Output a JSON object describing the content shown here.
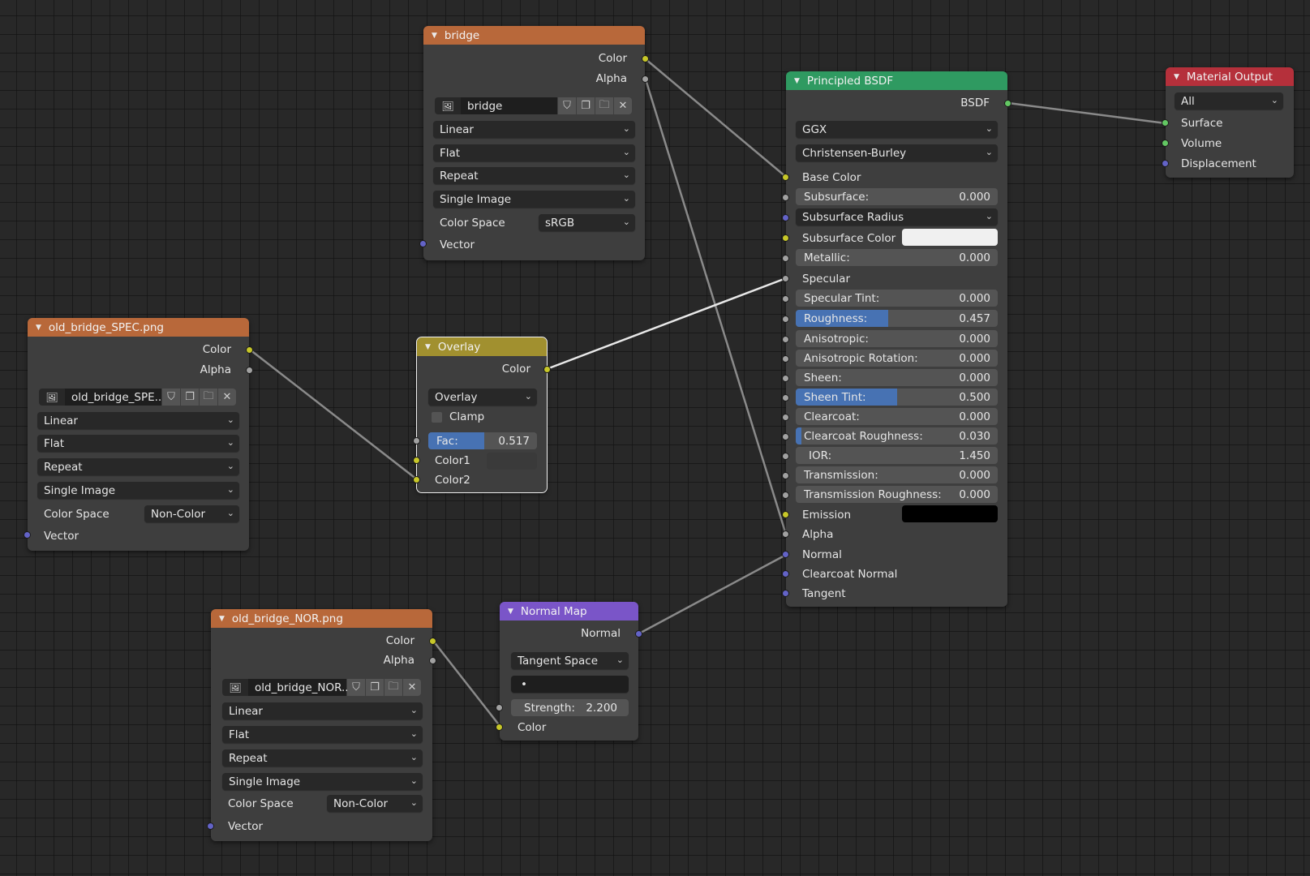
{
  "editor": "Shader Editor",
  "nodes": {
    "bridge": {
      "title": "bridge",
      "outputs": [
        "Color",
        "Alpha"
      ],
      "image_name": "bridge",
      "interpolation": "Linear",
      "projection": "Flat",
      "extension": "Repeat",
      "source": "Single Image",
      "color_space_label": "Color Space",
      "color_space": "sRGB",
      "inputs": [
        "Vector"
      ]
    },
    "spec": {
      "title": "old_bridge_SPEC.png",
      "outputs": [
        "Color",
        "Alpha"
      ],
      "image_name": "old_bridge_SPE..",
      "interpolation": "Linear",
      "projection": "Flat",
      "extension": "Repeat",
      "source": "Single Image",
      "color_space_label": "Color Space",
      "color_space": "Non-Color",
      "inputs": [
        "Vector"
      ]
    },
    "nor": {
      "title": "old_bridge_NOR.png",
      "outputs": [
        "Color",
        "Alpha"
      ],
      "image_name": "old_bridge_NOR..",
      "interpolation": "Linear",
      "projection": "Flat",
      "extension": "Repeat",
      "source": "Single Image",
      "color_space_label": "Color Space",
      "color_space": "Non-Color",
      "inputs": [
        "Vector"
      ]
    },
    "overlay": {
      "title": "Overlay",
      "output": "Color",
      "blend_type": "Overlay",
      "clamp_label": "Clamp",
      "clamp": false,
      "fac_label": "Fac:",
      "fac": 0.517,
      "fac_text": "0.517",
      "color1": "Color1",
      "color2": "Color2",
      "selected": true
    },
    "normal_map": {
      "title": "Normal Map",
      "output": "Normal",
      "space": "Tangent Space",
      "uv_map": "•",
      "strength_label": "Strength:",
      "strength": "2.200",
      "color_input": "Color"
    },
    "bsdf": {
      "title": "Principled BSDF",
      "output": "BSDF",
      "distribution": "GGX",
      "subsurface_method": "Christensen-Burley",
      "base_color": "Base Color",
      "subsurface": {
        "label": "Subsurface:",
        "value": "0.000",
        "fraction": 0
      },
      "subsurface_radius": "Subsurface Radius",
      "subsurface_color": {
        "label": "Subsurface Color",
        "color": "#f0f0f0"
      },
      "metallic": {
        "label": "Metallic:",
        "value": "0.000",
        "fraction": 0
      },
      "specular": "Specular",
      "specular_tint": {
        "label": "Specular Tint:",
        "value": "0.000",
        "fraction": 0
      },
      "roughness": {
        "label": "Roughness:",
        "value": "0.457",
        "fraction": 0.457
      },
      "anisotropic": {
        "label": "Anisotropic:",
        "value": "0.000",
        "fraction": 0
      },
      "anisotropic_rotation": {
        "label": "Anisotropic Rotation:",
        "value": "0.000",
        "fraction": 0
      },
      "sheen": {
        "label": "Sheen:",
        "value": "0.000",
        "fraction": 0
      },
      "sheen_tint": {
        "label": "Sheen Tint:",
        "value": "0.500",
        "fraction": 0.5
      },
      "clearcoat": {
        "label": "Clearcoat:",
        "value": "0.000",
        "fraction": 0
      },
      "clearcoat_roughness": {
        "label": "Clearcoat Roughness:",
        "value": "0.030",
        "fraction": 0.03
      },
      "ior": {
        "label": "IOR:",
        "value": "1.450"
      },
      "transmission": {
        "label": "Transmission:",
        "value": "0.000",
        "fraction": 0
      },
      "transmission_roughness": {
        "label": "Transmission Roughness:",
        "value": "0.000",
        "fraction": 0
      },
      "emission": {
        "label": "Emission",
        "color": "#000000"
      },
      "alpha": "Alpha",
      "normal": "Normal",
      "clearcoat_normal": "Clearcoat Normal",
      "tangent": "Tangent"
    },
    "output": {
      "title": "Material Output",
      "target": "All",
      "inputs": [
        "Surface",
        "Volume",
        "Displacement"
      ]
    }
  },
  "icons": {
    "collapse": "▼",
    "chevron": "⌄",
    "image_type": "🖼",
    "fake_user": "⛉",
    "duplicate": "❐",
    "open": "🗀",
    "unlink": "✕"
  },
  "colors": {
    "texture_header": "#b8683a",
    "shader_header": "#2f9a61",
    "output_header": "#b5303b",
    "color_header": "#a1902f",
    "vector_header": "#7a55c8",
    "socket_color": "#c7c729",
    "socket_float": "#a1a1a1",
    "socket_vector": "#6363c7",
    "socket_shader": "#63c763",
    "slider_fill": "#4772b3"
  }
}
